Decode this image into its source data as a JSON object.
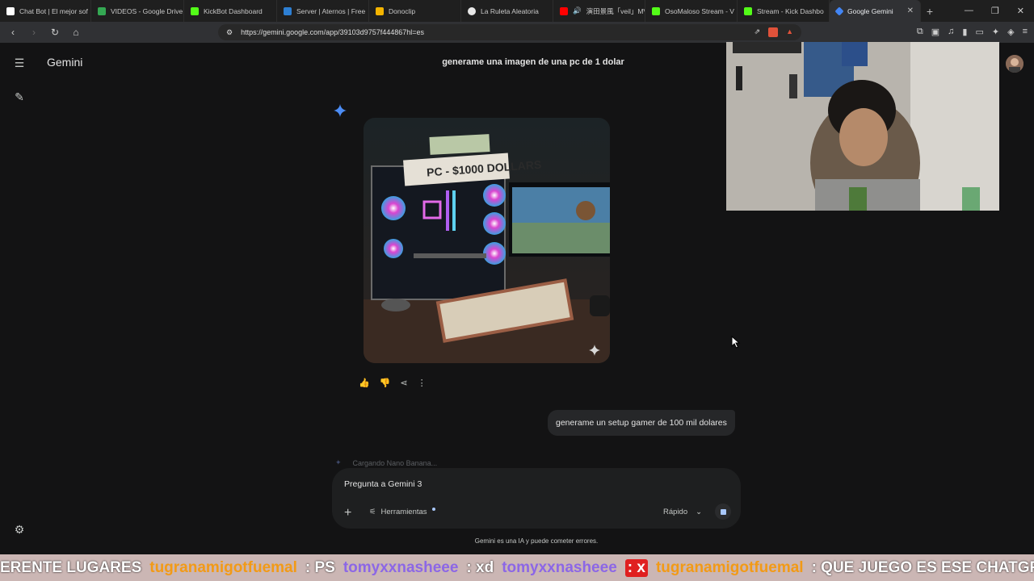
{
  "browser": {
    "tabs": [
      {
        "label": "Chat Bot | El mejor sof",
        "color": "#ffffff"
      },
      {
        "label": "VIDEOS - Google Drive",
        "color": "#34a853"
      },
      {
        "label": "KickBot Dashboard",
        "color": "#53fc18"
      },
      {
        "label": "Server | Aternos | Free",
        "color": "#2d7fd3"
      },
      {
        "label": "Donoclip",
        "color": "#f4b400"
      },
      {
        "label": "La Ruleta Aleatoria",
        "color": "#e8e8e8"
      },
      {
        "label": "演田景風「veil」MV",
        "color": "#ff0000"
      },
      {
        "label": "OsoMaloso Stream - V",
        "color": "#53fc18"
      },
      {
        "label": "Stream - Kick Dashbo",
        "color": "#53fc18"
      },
      {
        "label": "Google Gemini",
        "color": "#4285f4"
      }
    ],
    "url": "https://gemini.google.com/app/39103d9757f444867hl=es"
  },
  "gemini": {
    "brand": "Gemini",
    "prompt_top": "generame una imagen de una pc de 1 dolar",
    "image_caption": "PC - $1000 DOLLARS",
    "user_message": "generame un setup gamer de 100 mil dolares",
    "loading_text": "Cargando Nano Banana...",
    "composer_placeholder": "Pregunta a Gemini 3",
    "tools_label": "Herramientas",
    "mode_label": "Rápido",
    "disclaimer": "Gemini es una IA y puede cometer errores."
  },
  "ticker": {
    "items": [
      {
        "text": "ERENTE LUGARES",
        "style": "w"
      },
      {
        "text": "tugranamigotfuemal",
        "style": "o"
      },
      {
        "text": ": PS",
        "style": "w"
      },
      {
        "text": "tomyxxnasheee",
        "style": "p"
      },
      {
        "text": ": xd",
        "style": "w"
      },
      {
        "text": "tomyxxnasheee",
        "style": "p"
      },
      {
        "text": ": x",
        "style": "bx"
      },
      {
        "text": "tugranamigotfuemal",
        "style": "o"
      },
      {
        "text": ": QUE JUEGO ES ESE CHATGPT",
        "style": "w"
      }
    ]
  }
}
